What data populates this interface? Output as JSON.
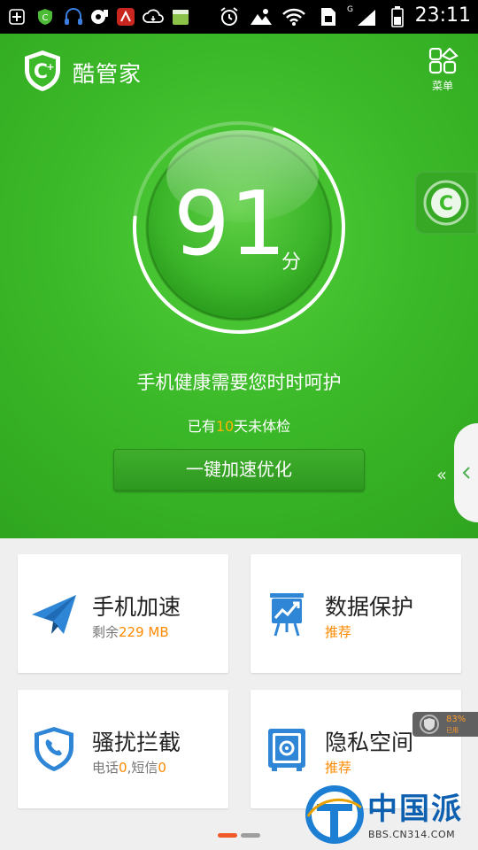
{
  "status_bar": {
    "time": "23:11",
    "network": "G",
    "notification_icons": [
      "add-icon",
      "app-shield-icon",
      "headset-icon",
      "media-icon",
      "antutu-icon",
      "cloud-icon",
      "android-box-icon"
    ],
    "system_icons": [
      "alarm-icon",
      "landscape-icon",
      "wifi-icon",
      "sim-icon",
      "signal-icon",
      "battery-icon"
    ]
  },
  "header": {
    "app_name": "酷管家",
    "menu_label": "菜单"
  },
  "health": {
    "score": "91",
    "score_unit": "分",
    "score_fraction": 0.91,
    "message": "手机健康需要您时时呵护",
    "checkup_prefix": "已有",
    "checkup_days": "10",
    "checkup_suffix": "天未体检",
    "boost_button": "一键加速优化"
  },
  "cards": [
    {
      "title": "手机加速",
      "sub_prefix": "剩余",
      "sub_value": "229 MB",
      "icon": "paper-plane-icon"
    },
    {
      "title": "数据保护",
      "sub": "推荐",
      "icon": "chart-board-icon"
    },
    {
      "title": "骚扰拦截",
      "sub_a": "电话",
      "sub_a_val": "0",
      "sub_sep": ",短信",
      "sub_b_val": "0",
      "icon": "phone-shield-icon"
    },
    {
      "title": "隐私空间",
      "sub": "推荐",
      "icon": "safe-icon"
    }
  ],
  "mini_meter": {
    "percent": "83%",
    "label": "已用"
  },
  "watermark": {
    "text": "中国派",
    "url": "BBS.CN314.COM"
  },
  "colors": {
    "brand_green": "#3cba29",
    "accent_orange": "#ff8a00",
    "icon_blue": "#2f86d6"
  }
}
